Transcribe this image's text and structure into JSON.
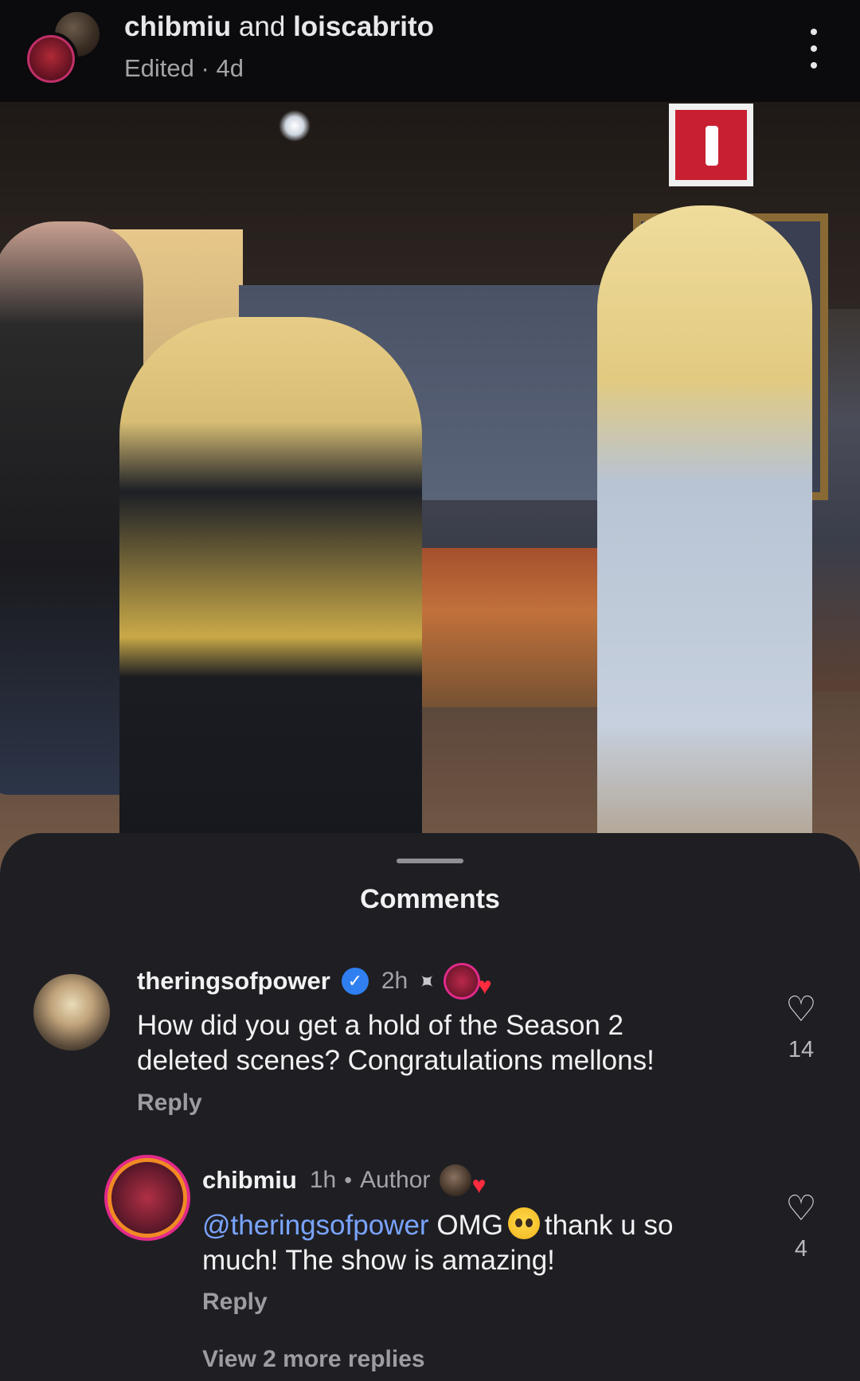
{
  "header": {
    "user_a": "chibmiu",
    "joiner": "and",
    "user_b": "loiscabrito",
    "subtitle": "Edited · 4d",
    "menu_icon": "more-vertical-icon"
  },
  "video": {
    "description_icon": "video-frame"
  },
  "comments_sheet": {
    "title": "Comments",
    "comments": [
      {
        "username": "theringsofpower",
        "verified_icon": "✓",
        "time": "2h",
        "pin_icon": "📌",
        "text": "How did you get a hold of the Season 2 deleted scenes? Congratulations mellons!",
        "reply_label": "Reply",
        "like_count": "14"
      },
      {
        "username": "chibmiu",
        "time": "1h",
        "separator": "•",
        "author_label": "Author",
        "mention": "@theringsofpower",
        "text_before_emoji": "OMG",
        "text_after_emoji": "thank u so much! The show is amazing!",
        "reply_label": "Reply",
        "like_count": "4"
      }
    ],
    "view_more": "View 2 more replies"
  },
  "colors": {
    "sheet_bg": "#1f1f23",
    "mention": "#7aa4ff",
    "verified": "#2f7ff0",
    "heart_red": "#ff2b3e"
  }
}
